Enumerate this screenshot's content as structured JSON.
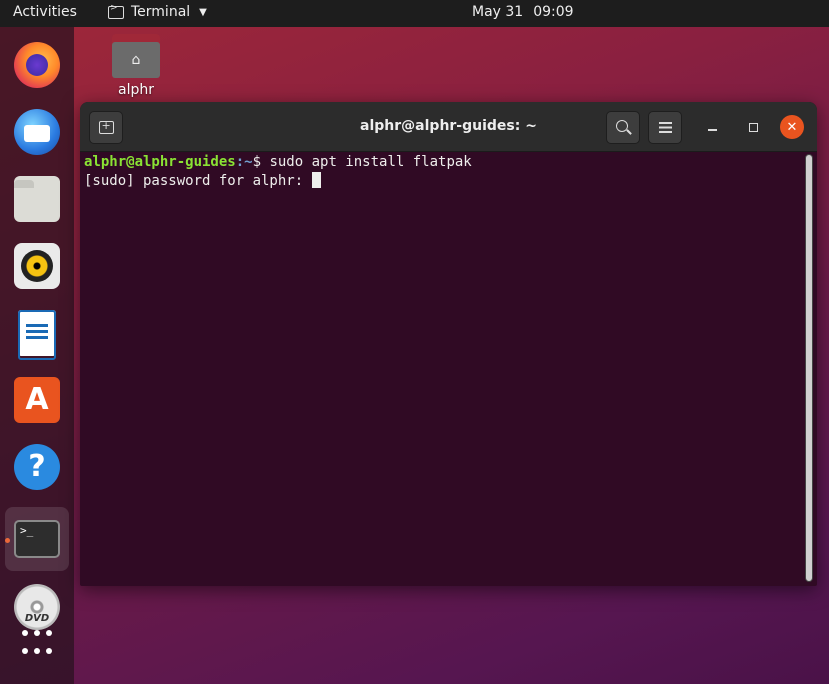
{
  "topbar": {
    "activities": "Activities",
    "app_name": "Terminal",
    "date": "May 31",
    "time": "09:09"
  },
  "dock": {
    "items": [
      {
        "name": "firefox",
        "icon": "firefox-icon"
      },
      {
        "name": "thunderbird",
        "icon": "thunderbird-icon"
      },
      {
        "name": "files",
        "icon": "files-icon"
      },
      {
        "name": "rhythmbox",
        "icon": "rhythmbox-icon"
      },
      {
        "name": "libreoffice-writer",
        "icon": "writer-icon"
      },
      {
        "name": "ubuntu-software",
        "icon": "software-store-icon",
        "glyph": "A"
      },
      {
        "name": "help",
        "icon": "help-icon",
        "glyph": "?"
      },
      {
        "name": "terminal",
        "icon": "terminal-icon",
        "glyph": ">_",
        "running": true,
        "active": true
      },
      {
        "name": "dvd",
        "icon": "dvd-icon",
        "glyph": "DVD"
      }
    ],
    "running_indicator_color": "#e9541f"
  },
  "desktop": {
    "home_folder_label": "alphr"
  },
  "terminal": {
    "title": "alphr@alphr-guides: ~",
    "lines": [
      {
        "user_host": "alphr@alphr-guides",
        "path": ":~",
        "prompt_symbol": "$",
        "command": " sudo apt install flatpak"
      },
      {
        "text": "[sudo] password for alphr: "
      }
    ],
    "colors": {
      "background": "#300a24",
      "user_host": "#8ae234",
      "path": "#729fcf",
      "text": "#eeeeec",
      "close_button": "#e9541f"
    }
  }
}
